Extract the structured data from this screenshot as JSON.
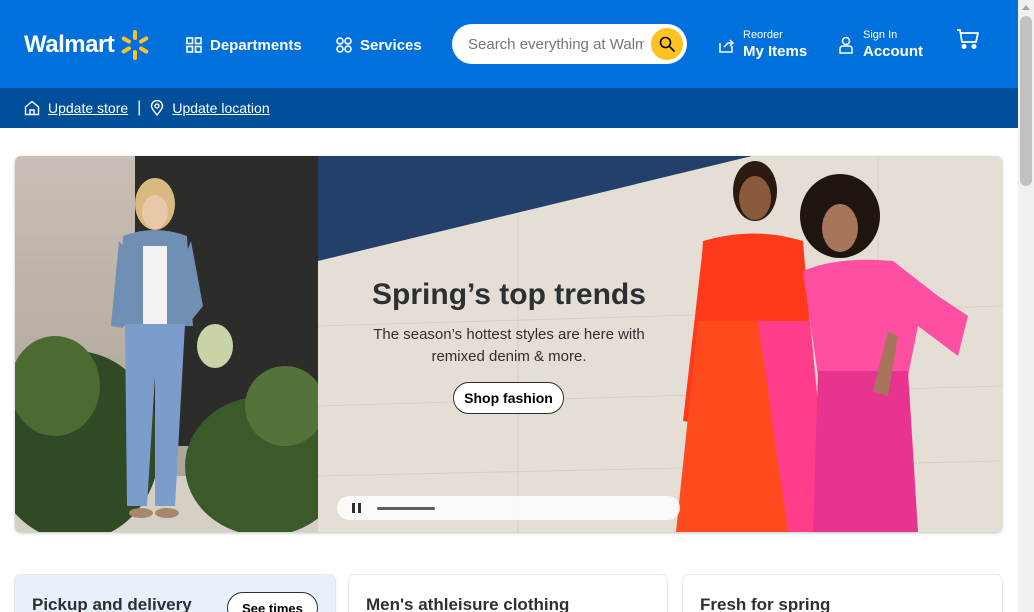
{
  "header": {
    "logo_text": "Walmart",
    "departments_label": "Departments",
    "services_label": "Services",
    "search_placeholder": "Search everything at Walmart online and in store",
    "reorder_small": "Reorder",
    "reorder_big": "My Items",
    "signin_small": "Sign In",
    "signin_big": "Account",
    "colors": {
      "brand_blue": "#0071dc",
      "spark_yellow": "#ffc220",
      "sub_blue": "#004f9a"
    }
  },
  "subheader": {
    "update_store": "Update store",
    "separator": "|",
    "update_location": "Update location"
  },
  "hero": {
    "title": "Spring’s top trends",
    "subtitle": "The season’s hottest styles are here with remixed denim & more.",
    "cta": "Shop fashion"
  },
  "cards": [
    {
      "title": "Pickup and delivery",
      "button": "See times"
    },
    {
      "title": "Men's athleisure clothing"
    },
    {
      "title": "Fresh for spring"
    }
  ],
  "icons": {
    "spark": "walmart-spark-icon",
    "grid": "grid-icon",
    "services": "services-icon",
    "search": "search-icon",
    "reorder": "reorder-icon",
    "user": "user-icon",
    "cart": "cart-icon",
    "store": "store-icon",
    "location": "location-pin-icon",
    "pause": "pause-icon"
  }
}
